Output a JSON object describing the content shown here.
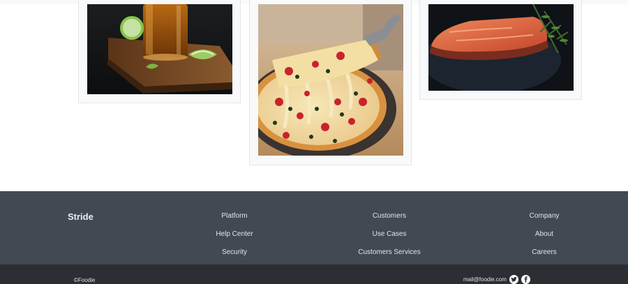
{
  "footer": {
    "brand": "Stride",
    "columns": [
      {
        "links": [
          "Platform",
          "Help Center",
          "Security"
        ]
      },
      {
        "links": [
          "Customers",
          "Use Cases",
          "Customers Services"
        ]
      },
      {
        "links": [
          "Company",
          "About",
          "Careers"
        ]
      }
    ],
    "copyright": "©Foodie",
    "email": "mail@foodie.com",
    "social": [
      {
        "icon": "twitter-icon"
      },
      {
        "icon": "facebook-icon"
      }
    ]
  },
  "colors": {
    "footer_bg": "#424953",
    "footer_bottom_bg": "#2b2f33",
    "card_bg": "#f8f9fa"
  }
}
